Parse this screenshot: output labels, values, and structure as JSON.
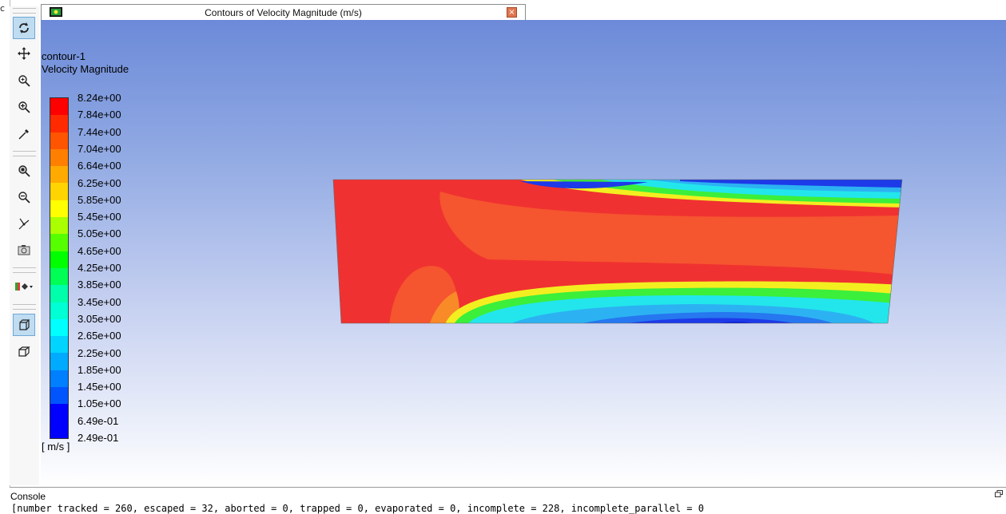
{
  "left_edge_mark": "c",
  "tab": {
    "title": "Contours of Velocity Magnitude (m/s)",
    "close_glyph": "×",
    "app_icon": "fluent-window-icon"
  },
  "toolbar": {
    "tools": [
      {
        "icon": "rotate-icon",
        "active": true
      },
      {
        "icon": "pan-icon",
        "active": false
      },
      {
        "icon": "zoom-in-out-icon",
        "active": false
      },
      {
        "icon": "zoom-to-area-icon",
        "active": false
      },
      {
        "icon": "probe-icon",
        "active": false
      },
      {
        "icon": "fit-to-window-icon",
        "active": false
      },
      {
        "icon": "zoom-out-icon",
        "active": false
      },
      {
        "icon": "view-axes-icon",
        "active": false
      },
      {
        "icon": "screenshot-icon",
        "active": false
      },
      {
        "icon": "colormap-display-icon",
        "active": false
      },
      {
        "icon": "orthographic-projection-icon",
        "active": true
      },
      {
        "icon": "perspective-projection-icon",
        "active": false
      }
    ]
  },
  "legend": {
    "object_name": "contour-1",
    "field_name": "Velocity Magnitude",
    "unit": "[ m/s ]",
    "labels": [
      "8.24e+00",
      "7.84e+00",
      "7.44e+00",
      "7.04e+00",
      "6.64e+00",
      "6.25e+00",
      "5.85e+00",
      "5.45e+00",
      "5.05e+00",
      "4.65e+00",
      "4.25e+00",
      "3.85e+00",
      "3.45e+00",
      "3.05e+00",
      "2.65e+00",
      "2.25e+00",
      "1.85e+00",
      "1.45e+00",
      "1.05e+00",
      "6.49e-01",
      "2.49e-01"
    ],
    "colors": [
      "#ff0000",
      "#ff2a00",
      "#ff5500",
      "#ff7f00",
      "#ffaa00",
      "#ffd400",
      "#ffff00",
      "#aaff00",
      "#55ff00",
      "#00ff00",
      "#00ff55",
      "#00ffaa",
      "#00ffd4",
      "#00ffff",
      "#00d4ff",
      "#00aaff",
      "#007fff",
      "#0055ff",
      "#0000ff",
      "#0000ff"
    ]
  },
  "contour_colors": {
    "red": "#f03131",
    "orange_red": "#f5552f",
    "orange": "#f98a28",
    "yellow": "#f3ee20",
    "green": "#3bef3b",
    "cyan": "#22e6ec",
    "light_blue": "#2cb2f2",
    "blue": "#2677f0",
    "deep_blue": "#1d3ae8",
    "dark_blue": "#0a1ad6"
  },
  "console": {
    "label": "Console",
    "restore_icon": "restore-window-icon",
    "output": "[number tracked = 260, escaped = 32, aborted = 0, trapped = 0, evaporated = 0, incomplete = 228, incomplete_parallel = 0"
  }
}
